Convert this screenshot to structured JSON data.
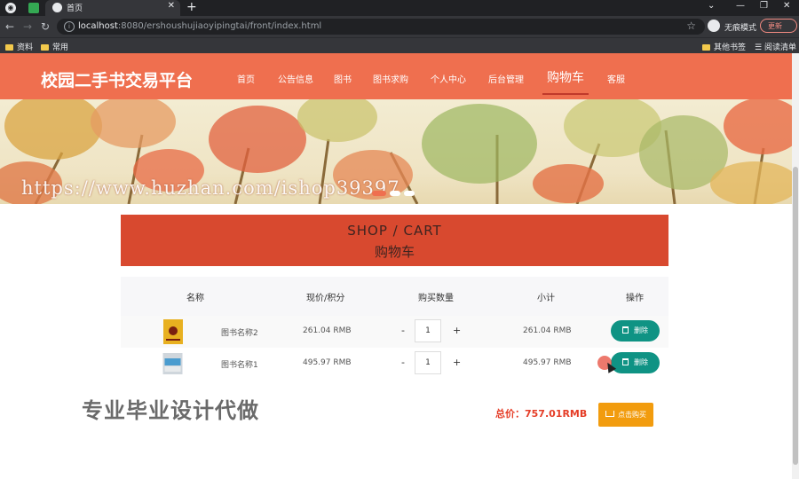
{
  "browser": {
    "tab_title": "首页",
    "url_host": "localhost",
    "url_path": ":8080/ershoushujiaoyipingtai/front/index.html",
    "incognito_label": "无痕模式",
    "update_label": "更新",
    "bookmarks": [
      "资料",
      "常用"
    ],
    "other_bookmarks": "其他书签",
    "reading_list": "阅读清单"
  },
  "site": {
    "title": "校园二手书交易平台",
    "nav": [
      "首页",
      "公告信息",
      "图书",
      "图书求购",
      "个人中心",
      "后台管理",
      "购物车",
      "客服"
    ],
    "active_nav": "购物车",
    "watermark": "https://www.huzhan.com/ishop39397"
  },
  "cart": {
    "heading_en": "SHOP / CART",
    "heading_zh": "购物车",
    "columns": [
      "名称",
      "现价/积分",
      "购买数量",
      "小计",
      "操作"
    ],
    "rows": [
      {
        "name": "图书名称2",
        "price": "261.04 RMB",
        "qty": "1",
        "subtotal": "261.04 RMB"
      },
      {
        "name": "图书名称1",
        "price": "495.97 RMB",
        "qty": "1",
        "subtotal": "495.97 RMB"
      }
    ],
    "minus_label": "-",
    "plus_label": "+",
    "delete_label": "删除",
    "total_label": "总价：757.01RMB",
    "buy_label": "点击购买",
    "overlay_text": "专业毕业设计代做"
  },
  "colors": {
    "header": "#ef6f4f",
    "cart_heading": "#d8492f",
    "delete_button": "#0f9384",
    "buy_button": "#f29c0e",
    "total_text": "#e53d27"
  }
}
